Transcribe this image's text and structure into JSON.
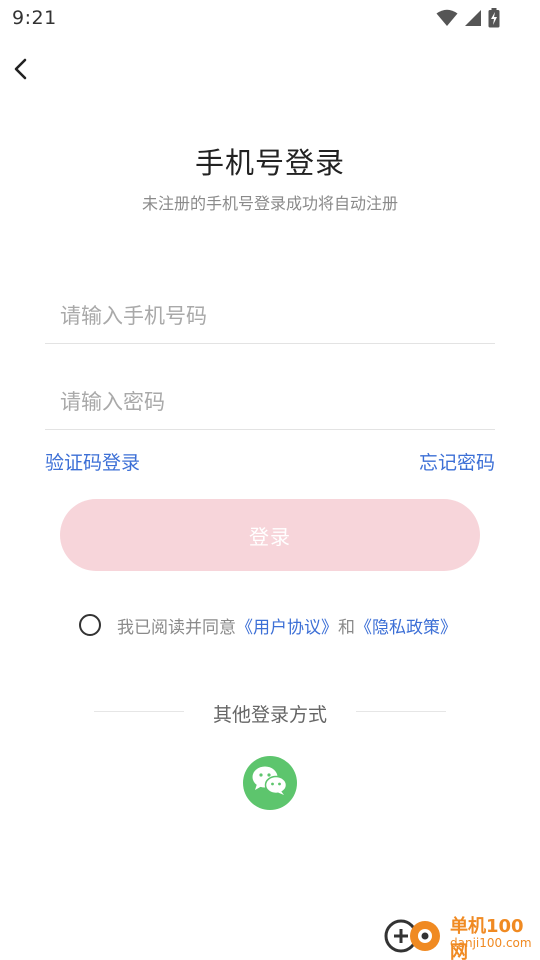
{
  "status_bar": {
    "time": "9:21",
    "icons": [
      "wifi-icon",
      "signal-icon",
      "battery-charging-icon"
    ]
  },
  "header": {
    "back_icon": "chevron-left-icon"
  },
  "title": "手机号登录",
  "subtitle": "未注册的手机号登录成功将自动注册",
  "form": {
    "phone_placeholder": "请输入手机号码",
    "phone_value": "",
    "password_placeholder": "请输入密码",
    "password_value": ""
  },
  "links": {
    "sms_login": "验证码登录",
    "forgot_password": "忘记密码"
  },
  "login_button": {
    "label": "登录",
    "color": "#f7d5da"
  },
  "agreement": {
    "checked": false,
    "prefix": "我已阅读并同意",
    "user_agreement": "《用户协议》",
    "and": "和",
    "privacy_policy": "《隐私政策》"
  },
  "other_login": {
    "label": "其他登录方式",
    "methods": [
      {
        "icon": "wechat-icon",
        "color": "#5dc56d"
      }
    ]
  },
  "watermark": {
    "title": "单机100网",
    "url": "danji100.com"
  },
  "colors": {
    "accent": "#3c6fd6",
    "placeholder": "#a9a9a9",
    "subtitle": "#8a8a8a"
  }
}
